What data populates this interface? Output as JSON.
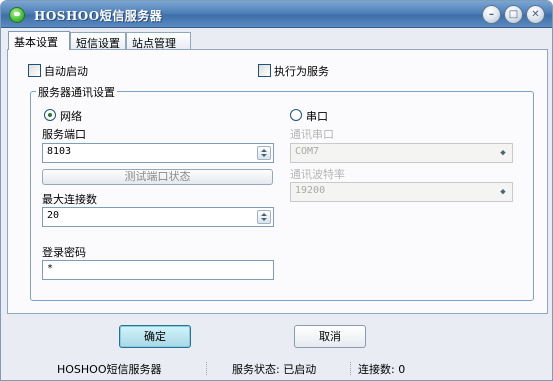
{
  "window": {
    "title": "HOSHOO短信服务器",
    "controls": {
      "minimize": "–",
      "maximize": "□",
      "close": "✕"
    }
  },
  "tabs": [
    {
      "label": "基本设置",
      "active": true
    },
    {
      "label": "短信设置",
      "active": false
    },
    {
      "label": "站点管理",
      "active": false
    }
  ],
  "basic": {
    "auto_start": {
      "label": "自动启动",
      "checked": false
    },
    "run_as_service": {
      "label": "执行为服务",
      "checked": false
    },
    "group_title": "服务器通讯设置",
    "network": {
      "label": "网络",
      "selected": true,
      "port_label": "服务端口",
      "port_value": "8103",
      "test_button": "测试端口状态",
      "max_conn_label": "最大连接数",
      "max_conn_value": "20",
      "password_label": "登录密码",
      "password_value": "*"
    },
    "serial": {
      "label": "串口",
      "selected": false,
      "port_label": "通讯串口",
      "port_value": "COM7",
      "baud_label": "通讯波特率",
      "baud_value": "19200"
    }
  },
  "buttons": {
    "ok": "确定",
    "cancel": "取消"
  },
  "status": {
    "app_name": "HOSHOO短信服务器",
    "service_status": "服务状态: 已启动",
    "connections": "连接数: 0"
  },
  "colors": {
    "accent": "#4f80b9",
    "ok_button": "#a8d8e6"
  }
}
